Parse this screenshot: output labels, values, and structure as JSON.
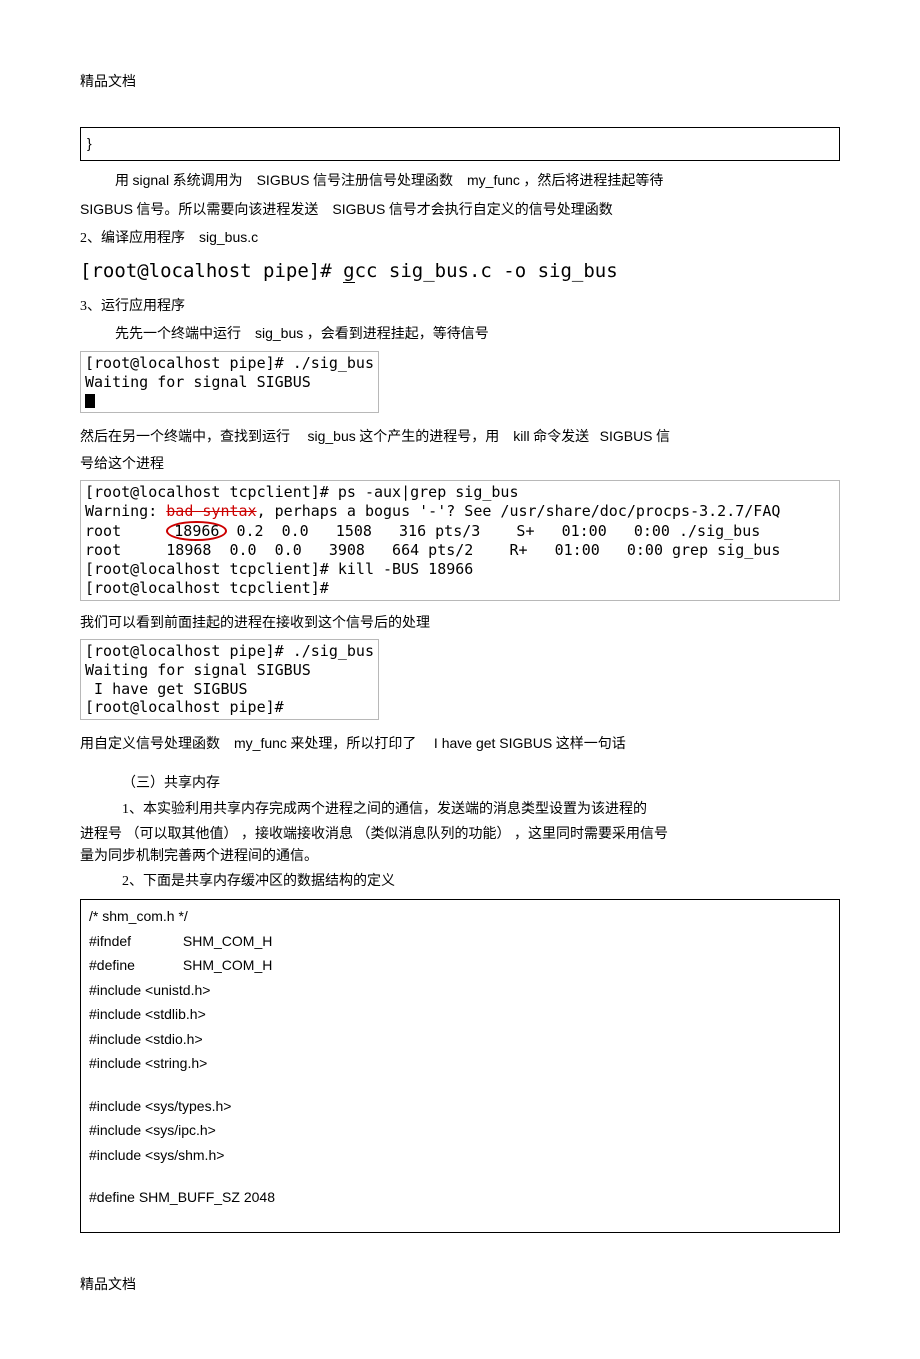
{
  "header": "精品文档",
  "footer": "精品文档",
  "codebox1": {
    "brace": "}"
  },
  "p1a": "用 ",
  "p1b": "signal",
  "p1c": " 系统调用为",
  "p1d": "SIGBUS",
  "p1e": " 信号注册信号处理函数",
  "p1f": "my_func",
  "p1g": " ，然后将进程挂起等待",
  "p2a": "SIGBUS",
  "p2b": " 信号。所以需要向该进程发送",
  "p2c": "SIGBUS",
  "p2d": " 信号才会执行自定义的信号处理函数",
  "step2a": "2、编译应用程序",
  "step2b": "sig_bus.c",
  "compile": "[root@localhost pipe]# gcc sig_bus.c -o sig_bus",
  "compile_prefix": "[root@localhost pipe]# ",
  "compile_g": "g",
  "compile_rest": "cc sig_bus.c -o sig_bus",
  "step3": "3、运行应用程序",
  "step3suba": "先先一个终端中运行",
  "step3subb": "sig_bus",
  "step3subc": "，会看到进程挂起，等待信号",
  "term1_l1": "[root@localhost pipe]# ./sig_bus",
  "term1_l2": "Waiting for signal SIGBUS",
  "p4a": "然后在另一个终端中，查找到运行",
  "p4b": "sig_bus",
  "p4c": " 这个产生的进程号，用",
  "p4d": "kill",
  "p4e": " 命令发送",
  "p4f": "SIGBUS",
  "p4g": " 信",
  "p4h": "号给这个进程",
  "term2_l1": "[root@localhost tcpclient]# ps -aux|grep sig_bus",
  "term2_l2a": "Warning: ",
  "term2_l2b": "bad syntax",
  "term2_l2c": ", perhaps a bogus '-'? See /usr/share/doc/procps-3.2.7/FAQ",
  "term2_l3a": "root     ",
  "term2_pid": "18966",
  "term2_l3b": " 0.2  0.0   1508   316 pts/3    S+   01:00   0:00 ./sig_bus",
  "term2_l4": "root     18968  0.0  0.0   3908   664 pts/2    R+   01:00   0:00 grep sig_bus",
  "term2_l5": "[root@localhost tcpclient]# kill -BUS 18966",
  "term2_l6": "[root@localhost tcpclient]#",
  "p5": "我们可以看到前面挂起的进程在接收到这个信号后的处理",
  "term3_l1": "[root@localhost pipe]# ./sig_bus",
  "term3_l2": "Waiting for signal SIGBUS",
  "term3_l3": " I have get SIGBUS",
  "term3_l4": "[root@localhost pipe]#",
  "p6a": "用自定义信号处理函数",
  "p6b": "my_func",
  "p6c": " 来处理，所以打印了",
  "p6d": "I have get SIGBUS",
  "p6e": " 这样一句话",
  "sec3": "（三）共享内存",
  "sec3p1": "1、本实验利用共享内存完成两个进程之间的通信，发送端的消息类型设置为该进程的",
  "sec3p1b": "进程号 （可以取其他值） ，接收端接收消息 （类似消息队列的功能） ，这里同时需要采用信号量为同步机制完善两个进程间的通信。",
  "sec3p1b_l1": "进程号 （可以取其他值） ，接收端接收消息 （类似消息队列的功能） ，这里同时需要采用信号",
  "sec3p1b_l2": "量为同步机制完善两个进程间的通信。",
  "sec3p2": "2、下面是共享内存缓冲区的数据结构的定义",
  "codebox2": {
    "l1": "/* shm_com.h */",
    "l2a": "#ifndef",
    "l2b": "SHM_COM_H",
    "l3a": "#define",
    "l3b": "SHM_COM_H",
    "l4": "#include <unistd.h>",
    "l5": "#include <stdlib.h>",
    "l6": "#include <stdio.h>",
    "l7": "#include <string.h>",
    "l8": "#include <sys/types.h>",
    "l9": "#include <sys/ipc.h>",
    "l10": "#include <sys/shm.h>",
    "l11": "#define SHM_BUFF_SZ 2048"
  }
}
